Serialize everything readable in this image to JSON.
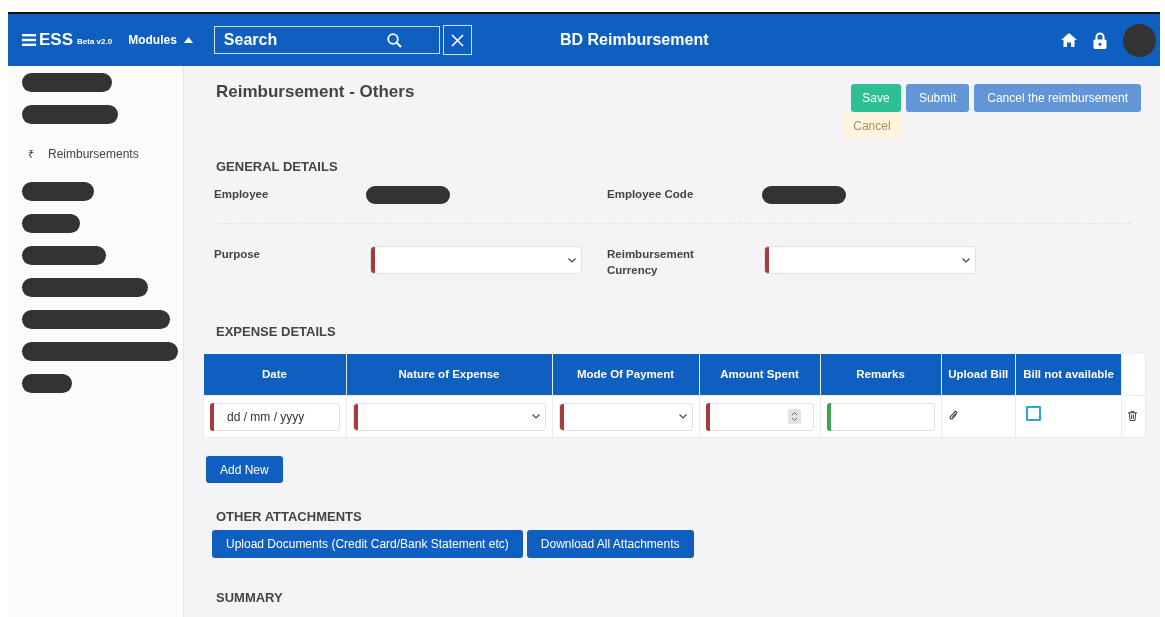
{
  "header": {
    "brand": "ESS",
    "brand_badge": "Beta v2.0",
    "modules_label": "Modules",
    "modules_expanded": true,
    "search": {
      "placeholder": "Search"
    },
    "title": "BD Reimbursement"
  },
  "sidebar": {
    "items": [
      {
        "kind": "redacted"
      },
      {
        "kind": "redacted"
      },
      {
        "kind": "link",
        "icon": "₹",
        "label": "Reimbursements"
      },
      {
        "kind": "redacted"
      },
      {
        "kind": "redacted"
      },
      {
        "kind": "redacted"
      },
      {
        "kind": "redacted"
      },
      {
        "kind": "redacted"
      },
      {
        "kind": "redacted"
      },
      {
        "kind": "redacted"
      }
    ]
  },
  "page": {
    "title": "Reimbursement - Others",
    "actions": [
      {
        "label": "Save",
        "kind": "success"
      },
      {
        "label": "Submit",
        "kind": "primary"
      },
      {
        "label": "Cancel the reimbursement",
        "kind": "primary"
      }
    ],
    "faded_action": "Cancel"
  },
  "general_details": {
    "heading": "GENERAL DETAILS",
    "rows": [
      [
        {
          "label": "Employee",
          "kind": "redacted"
        },
        {
          "label": "Employee Code",
          "kind": "redacted"
        }
      ],
      [
        {
          "label": "Purpose",
          "kind": "select",
          "color": "#a93a3a"
        },
        {
          "label": "Reimbursement Currency",
          "kind": "select",
          "color": "#a93a3a"
        }
      ]
    ]
  },
  "expense_details": {
    "heading": "EXPENSE DETAILS",
    "columns": [
      "Date",
      "Nature of Expense",
      "Mode Of Payment",
      "Amount Spent",
      "Remarks",
      "Upload Bill",
      "Bill not available"
    ],
    "rows": [
      [
        {
          "kind": "date",
          "placeholder": "dd / mm / yyyy",
          "color": "#a93a3a"
        },
        {
          "kind": "select",
          "color": "#a93a3a"
        },
        {
          "kind": "select",
          "color": "#a93a3a"
        },
        {
          "kind": "number",
          "color": "#a93a3a"
        },
        {
          "kind": "text",
          "color": "#3fa34d"
        },
        {
          "kind": "attach"
        },
        {
          "kind": "checkbox",
          "checked": false
        },
        {
          "kind": "delete"
        }
      ]
    ],
    "add_button": "Add New"
  },
  "other_attachments": {
    "heading": "OTHER ATTACHMENTS",
    "buttons": [
      "Upload Documents (Credit Card/Bank Statement etc)",
      "Download All Attachments"
    ]
  },
  "summary": {
    "heading": "SUMMARY"
  }
}
